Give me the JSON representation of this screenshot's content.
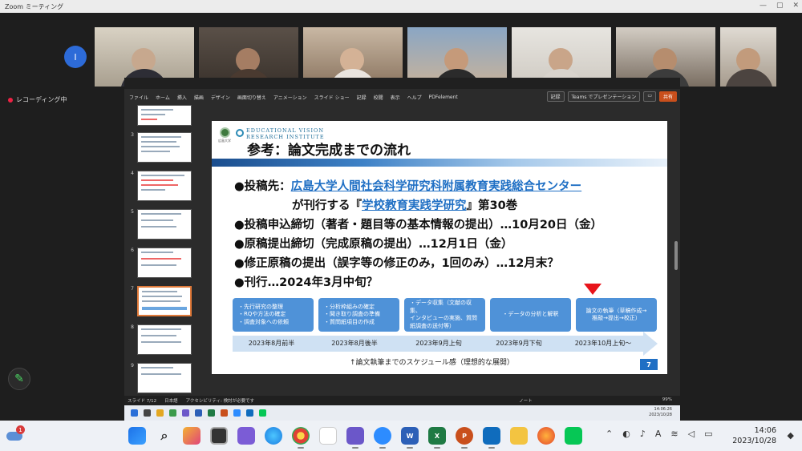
{
  "zoom": {
    "window_title": "Zoom ミーティング",
    "recording_label": "レコーディング中",
    "self_initial": "I"
  },
  "ribbon": {
    "tabs": [
      "ファイル",
      "ホーム",
      "挿入",
      "描画",
      "デザイン",
      "画面切り替え",
      "アニメーション",
      "スライド ショー",
      "記録",
      "校閲",
      "表示",
      "ヘルプ",
      "PDFelement"
    ],
    "record_btn": "記録",
    "teams_btn": "Teams でプレゼンテーション",
    "share_btn": "共有"
  },
  "thumbnails": [
    {
      "num": "3"
    },
    {
      "num": "4"
    },
    {
      "num": "5"
    },
    {
      "num": "6"
    },
    {
      "num": "7"
    },
    {
      "num": "8"
    },
    {
      "num": "9"
    }
  ],
  "status": {
    "slide_info": "スライド 7/12",
    "language": "日本語",
    "accessibility": "アクセシビリティ: 検討が必要です",
    "notes": "ノート",
    "zoom_level": "99%"
  },
  "slide": {
    "logo_name_1": "EDUCATIONAL VISION",
    "logo_name_2": "RESEARCH INSTITUTE",
    "logo_sub": "広島大学",
    "title": "参考：論文完成までの流れ",
    "bullet1_prefix": "●投稿先：",
    "bullet1_link": "広島大学人間社会科学研究科附属教育実践総合センター",
    "bullet1b_prefix": "が刊行する『",
    "bullet1b_link": "学校教育実践学研究",
    "bullet1b_suffix": "』第30巻",
    "bullet2": "●投稿申込締切（著者・題目等の基本情報の提出）…10月20日（金）",
    "bullet3": "●原稿提出締切（完成原稿の提出）…12月1日（金）",
    "bullet4": "●修正原稿の提出（誤字等の修正のみ，1回のみ）…12月末？",
    "bullet5": "●刊行…2024年3月中旬？",
    "boxes": [
      {
        "lines": [
          "・先行研究の整理",
          "・RQや方法の確定",
          "・調査対象への依頼"
        ]
      },
      {
        "lines": [
          "・分析枠組みの確定",
          "・聞き取り調査の準備",
          "・質問紙項目の作成"
        ]
      },
      {
        "lines": [
          "・データ収集（文献の収集、",
          "インタビューの実施、質問",
          "紙調査の送付等）"
        ]
      },
      {
        "lines": [
          "・データの分析と解釈"
        ]
      },
      {
        "lines": [
          "論文の執筆（草稿作成→",
          "推敲→提出→校正）"
        ]
      }
    ],
    "dates": [
      "2023年8月前半",
      "2023年8月後半",
      "2023年9月上旬",
      "2023年9月下旬",
      "2023年10月上旬～"
    ],
    "caption": "↑論文執筆までのスケジュール感（理想的な展開）",
    "page_number": "7"
  },
  "mini_clock": {
    "time": "14:06:26",
    "date": "2023/10/28"
  },
  "taskbar": {
    "notification_count": "1",
    "time": "14:06",
    "date": "2023/10/28"
  }
}
